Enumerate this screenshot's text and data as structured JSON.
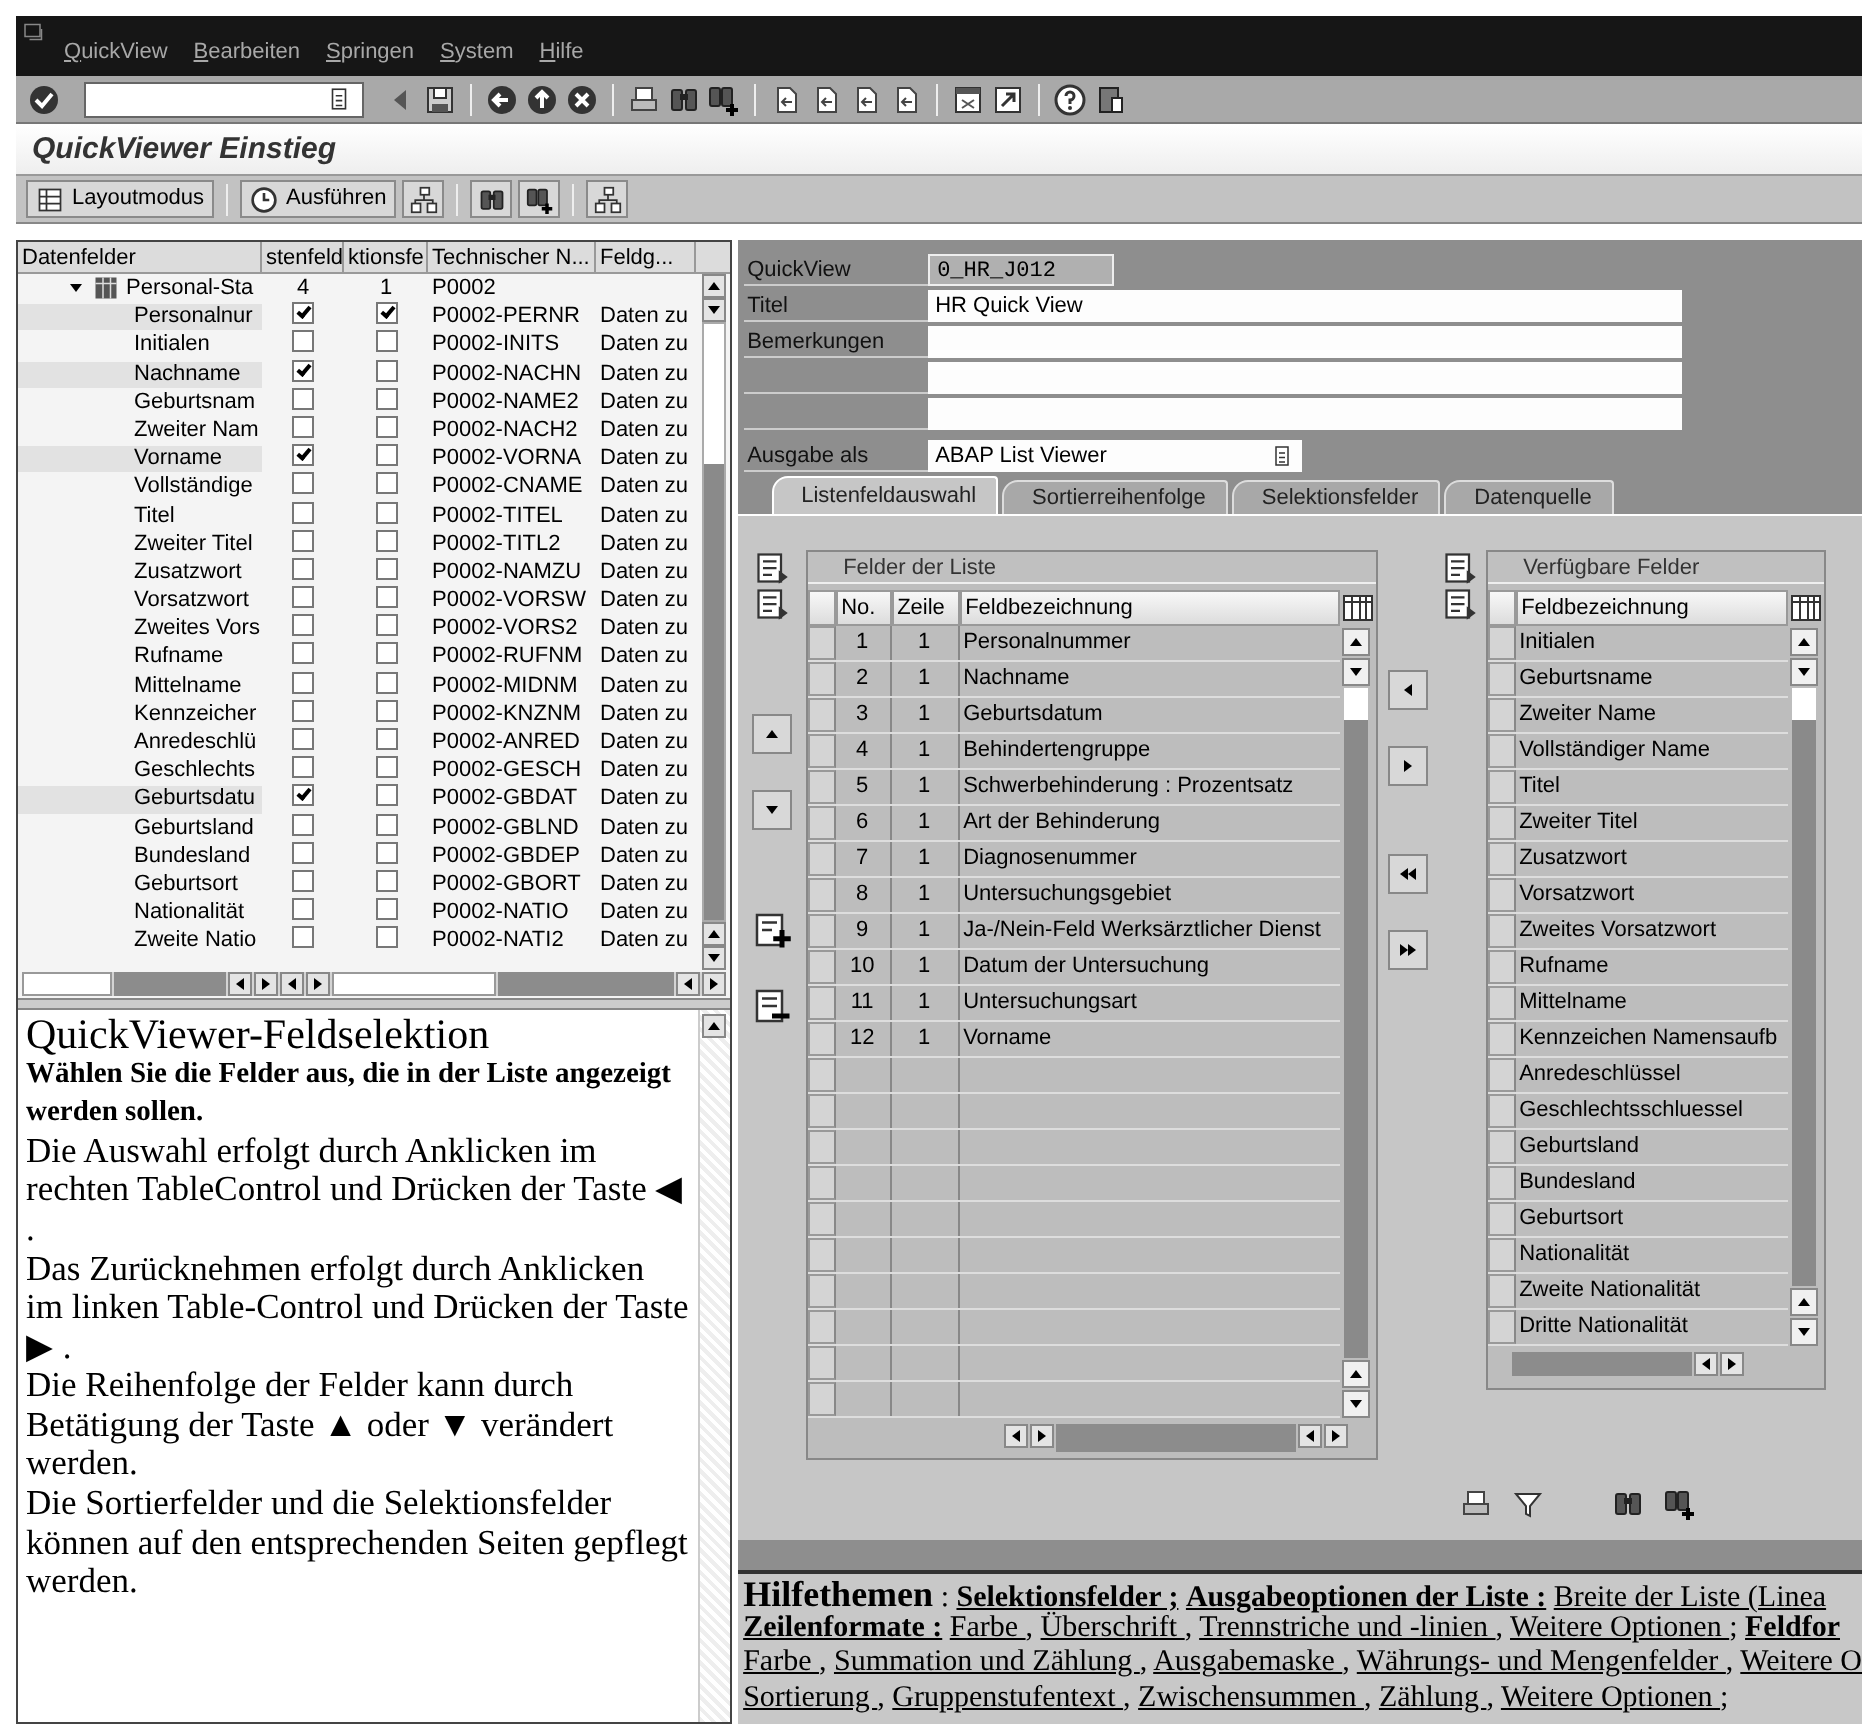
{
  "menu_bar": [
    "QuickView",
    "Bearbeiten",
    "Springen",
    "System",
    "Hilfe"
  ],
  "screen_title": "QuickViewer Einstieg",
  "app_toolbar": {
    "buttons": [
      {
        "kind": "layout",
        "label": "Layoutmodus"
      },
      {
        "kind": "execute",
        "label": "Ausführen"
      }
    ]
  },
  "field_tree": {
    "columns": [
      "Datenfelder",
      "stenfeld",
      "ktionsfe",
      "Technischer N...",
      "Feldg..."
    ],
    "root": {
      "label": "Personal-Sta",
      "expanded": true,
      "list_count": "4",
      "selection_count": "1",
      "technical_name": "P0002",
      "children": [
        {
          "label": "Personalnur",
          "list_field": true,
          "selection_field": true,
          "technical_name": "P0002-PERNR",
          "group": "Daten zu"
        },
        {
          "label": "Initialen",
          "list_field": false,
          "selection_field": false,
          "technical_name": "P0002-INITS",
          "group": "Daten zu"
        },
        {
          "label": "Nachname",
          "list_field": true,
          "selection_field": false,
          "technical_name": "P0002-NACHN",
          "group": "Daten zu"
        },
        {
          "label": "Geburtsnam",
          "list_field": false,
          "selection_field": false,
          "technical_name": "P0002-NAME2",
          "group": "Daten zu"
        },
        {
          "label": "Zweiter Nam",
          "list_field": false,
          "selection_field": false,
          "technical_name": "P0002-NACH2",
          "group": "Daten zu"
        },
        {
          "label": "Vorname",
          "list_field": true,
          "selection_field": false,
          "technical_name": "P0002-VORNA",
          "group": "Daten zu"
        },
        {
          "label": "Vollständige",
          "list_field": false,
          "selection_field": false,
          "technical_name": "P0002-CNAME",
          "group": "Daten zu"
        },
        {
          "label": "Titel",
          "list_field": false,
          "selection_field": false,
          "technical_name": "P0002-TITEL",
          "group": "Daten zu"
        },
        {
          "label": "Zweiter Titel",
          "list_field": false,
          "selection_field": false,
          "technical_name": "P0002-TITL2",
          "group": "Daten zu"
        },
        {
          "label": "Zusatzwort",
          "list_field": false,
          "selection_field": false,
          "technical_name": "P0002-NAMZU",
          "group": "Daten zu"
        },
        {
          "label": "Vorsatzwort",
          "list_field": false,
          "selection_field": false,
          "technical_name": "P0002-VORSW",
          "group": "Daten zu"
        },
        {
          "label": "Zweites Vors",
          "list_field": false,
          "selection_field": false,
          "technical_name": "P0002-VORS2",
          "group": "Daten zu"
        },
        {
          "label": "Rufname",
          "list_field": false,
          "selection_field": false,
          "technical_name": "P0002-RUFNM",
          "group": "Daten zu"
        },
        {
          "label": "Mittelname",
          "list_field": false,
          "selection_field": false,
          "technical_name": "P0002-MIDNM",
          "group": "Daten zu"
        },
        {
          "label": "Kennzeicher",
          "list_field": false,
          "selection_field": false,
          "technical_name": "P0002-KNZNM",
          "group": "Daten zu"
        },
        {
          "label": "Anredeschlü",
          "list_field": false,
          "selection_field": false,
          "technical_name": "P0002-ANRED",
          "group": "Daten zu"
        },
        {
          "label": "Geschlechts",
          "list_field": false,
          "selection_field": false,
          "technical_name": "P0002-GESCH",
          "group": "Daten zu"
        },
        {
          "label": "Geburtsdatu",
          "list_field": true,
          "selection_field": false,
          "technical_name": "P0002-GBDAT",
          "group": "Daten zu"
        },
        {
          "label": "Geburtsland",
          "list_field": false,
          "selection_field": false,
          "technical_name": "P0002-GBLND",
          "group": "Daten zu"
        },
        {
          "label": "Bundesland",
          "list_field": false,
          "selection_field": false,
          "technical_name": "P0002-GBDEP",
          "group": "Daten zu"
        },
        {
          "label": "Geburtsort",
          "list_field": false,
          "selection_field": false,
          "technical_name": "P0002-GBORT",
          "group": "Daten zu"
        },
        {
          "label": "Nationalität",
          "list_field": false,
          "selection_field": false,
          "technical_name": "P0002-NATIO",
          "group": "Daten zu"
        },
        {
          "label": "Zweite Natio",
          "list_field": false,
          "selection_field": false,
          "technical_name": "P0002-NATI2",
          "group": "Daten zu"
        }
      ]
    }
  },
  "help": {
    "title": "QuickViewer-Feldselektion",
    "lead": "Wählen Sie die Felder aus, die in der Liste angezeigt werden sollen.",
    "paragraphs": [
      "Die Auswahl erfolgt durch Anklicken im rechten TableControl und Drücken der Taste ◀ .",
      "Das Zurücknehmen erfolgt durch Anklicken im linken Table-Control und Drücken der Taste ▶ .",
      "Die Reihenfolge der Felder kann durch Betätigung der Taste ▲ oder ▼ verändert werden.",
      "Die Sortierfelder und die Selektionsfelder können auf den entsprechenden Seiten gepflegt werden."
    ]
  },
  "form": [
    {
      "kind": "readonly",
      "label": "QuickView",
      "value": "0_HR_J012"
    },
    {
      "kind": "input",
      "label": "Titel",
      "value": "HR Quick View"
    },
    {
      "kind": "input",
      "label": "Bemerkungen"
    },
    {
      "kind": "input"
    },
    {
      "kind": "input"
    },
    {
      "kind": "dropdown",
      "label": "Ausgabe als",
      "value": "ABAP List Viewer"
    }
  ],
  "tabs": [
    {
      "label": "Listenfeldauswahl",
      "selected": true
    },
    {
      "label": "Sortierreihenfolge",
      "selected": false
    },
    {
      "label": "Selektionsfelder",
      "selected": false
    },
    {
      "label": "Datenquelle",
      "selected": false
    }
  ],
  "list_fields": {
    "title": "Felder der Liste",
    "columns": [
      "No.",
      "Zeile",
      "Feldbezeichnung"
    ],
    "rows": [
      {
        "no": "1",
        "line": "1",
        "name": "Personalnummer"
      },
      {
        "no": "2",
        "line": "1",
        "name": "Nachname"
      },
      {
        "no": "3",
        "line": "1",
        "name": "Geburtsdatum"
      },
      {
        "no": "4",
        "line": "1",
        "name": "Behindertengruppe"
      },
      {
        "no": "5",
        "line": "1",
        "name": "Schwerbehinderung : Prozentsatz"
      },
      {
        "no": "6",
        "line": "1",
        "name": "Art der Behinderung"
      },
      {
        "no": "7",
        "line": "1",
        "name": "Diagnosenummer"
      },
      {
        "no": "8",
        "line": "1",
        "name": "Untersuchungsgebiet"
      },
      {
        "no": "9",
        "line": "1",
        "name": "Ja-/Nein-Feld Werksärztlicher Dienst"
      },
      {
        "no": "10",
        "line": "1",
        "name": "Datum der Untersuchung"
      },
      {
        "no": "11",
        "line": "1",
        "name": "Untersuchungsart"
      },
      {
        "no": "12",
        "line": "1",
        "name": "Vorname"
      }
    ]
  },
  "available_fields": {
    "title": "Verfügbare Felder",
    "column": "Feldbezeichnung",
    "rows": [
      "Initialen",
      "Geburtsname",
      "Zweiter Name",
      "Vollständiger Name",
      "Titel",
      "Zweiter Titel",
      "Zusatzwort",
      "Vorsatzwort",
      "Zweites Vorsatzwort",
      "Rufname",
      "Mittelname",
      "Kennzeichen Namensaufb",
      "Anredeschlüssel",
      "Geschlechtsschluessel",
      "Geburtsland",
      "Bundesland",
      "Geburtsort",
      "Nationalität",
      "Zweite Nationalität",
      "Dritte Nationalität"
    ]
  },
  "help_topics": [
    [
      {
        "kind": "heading",
        "text": "Hilfethemen"
      },
      {
        "kind": "text",
        "text": " : "
      },
      {
        "kind": "label",
        "text": "Selektionsfelder ;"
      },
      {
        "kind": "label",
        "text": "Ausgabeoptionen der Liste :"
      },
      {
        "kind": "link",
        "text": "Breite der Liste (Linea"
      }
    ],
    [
      {
        "kind": "label",
        "text": "Zeilenformate :"
      },
      {
        "kind": "link",
        "text": "Farbe "
      },
      {
        "kind": "text",
        "text": ", "
      },
      {
        "kind": "link",
        "text": "Überschrift "
      },
      {
        "kind": "text",
        "text": ", "
      },
      {
        "kind": "link",
        "text": "Trennstriche und -linien "
      },
      {
        "kind": "text",
        "text": ", "
      },
      {
        "kind": "link",
        "text": "Weitere Optionen "
      },
      {
        "kind": "text",
        "text": "; "
      },
      {
        "kind": "label",
        "text": "Feldfor"
      }
    ],
    [
      {
        "kind": "link",
        "text": "Farbe "
      },
      {
        "kind": "text",
        "text": ", "
      },
      {
        "kind": "link",
        "text": "Summation und Zählung "
      },
      {
        "kind": "text",
        "text": ", "
      },
      {
        "kind": "link",
        "text": "Ausgabemaske "
      },
      {
        "kind": "text",
        "text": ", "
      },
      {
        "kind": "link",
        "text": "Währungs- und Mengenfelder "
      },
      {
        "kind": "text",
        "text": ", "
      },
      {
        "kind": "link",
        "text": "Weitere O"
      }
    ],
    [
      {
        "kind": "link",
        "text": "Sortierung "
      },
      {
        "kind": "text",
        "text": ", "
      },
      {
        "kind": "link",
        "text": "Gruppenstufentext "
      },
      {
        "kind": "text",
        "text": ", "
      },
      {
        "kind": "link",
        "text": "Zwischensummen "
      },
      {
        "kind": "text",
        "text": ", "
      },
      {
        "kind": "link",
        "text": "Zählung "
      },
      {
        "kind": "text",
        "text": ", "
      },
      {
        "kind": "link",
        "text": "Weitere Optionen "
      },
      {
        "kind": "text",
        "text": ";"
      }
    ]
  ]
}
